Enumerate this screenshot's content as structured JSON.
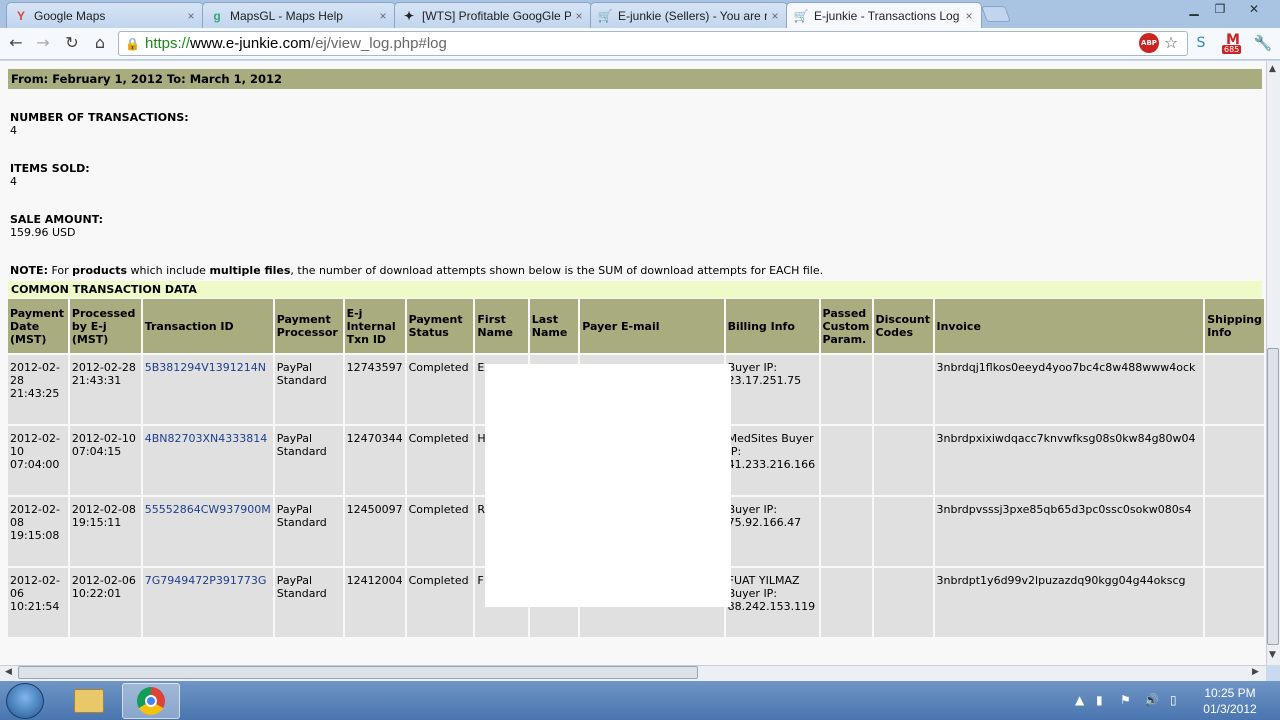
{
  "tabs": [
    {
      "label": "Google Maps",
      "icon": "google-icon",
      "close": "×"
    },
    {
      "label": "MapsGL - Maps Help",
      "icon": "google-icon",
      "close": "×"
    },
    {
      "label": "[WTS] Profitable GoogGle Pl",
      "icon": "forum-icon",
      "close": "×"
    },
    {
      "label": "E-junkie (Sellers) - You are r",
      "icon": "cart-icon",
      "close": "×"
    },
    {
      "label": "E-junkie - Transactions Log",
      "icon": "cart-icon",
      "close": "×"
    }
  ],
  "omnibox": {
    "scheme": "https://",
    "host": "www.e-junkie.com",
    "path": "/ej/view_log.php#log"
  },
  "extensions": {
    "abp": "ABP",
    "gmail_count": "685"
  },
  "report": {
    "range": "From: February 1, 2012 To: March 1, 2012",
    "num_transactions_label": "NUMBER OF TRANSACTIONS:",
    "num_transactions": "4",
    "items_sold_label": "ITEMS SOLD:",
    "items_sold": "4",
    "sale_amount_label": "SALE AMOUNT:",
    "sale_amount": "159.96 USD",
    "note_label": "NOTE:",
    "note_1": " For ",
    "note_products": "products",
    "note_2": " which include ",
    "note_multiple": "multiple files",
    "note_3": ", the number of download attempts shown below is the SUM of download attempts for EACH file.",
    "common_title": "COMMON TRANSACTION DATA"
  },
  "table": {
    "headers": [
      "Payment Date (MST)",
      "Processed by E-j (MST)",
      "Transaction ID",
      "Payment Processor",
      "E-j Internal Txn ID",
      "Payment Status",
      "First Name",
      "Last Name",
      "Payer E-mail",
      "Billing Info",
      "Passed Custom Param.",
      "Discount Codes",
      "Invoice",
      "Shipping Info"
    ],
    "rows": [
      {
        "pay_date": "2012-02-28 21:43:25",
        "proc_date": "2012-02-28 21:43:31",
        "txn_id": "5B381294V1391214N",
        "processor": "PayPal Standard",
        "internal_id": "12743597",
        "status": "Completed",
        "first": "E",
        "last": "",
        "email": "",
        "billing": "Buyer IP: 23.17.251.75",
        "custom": "",
        "discount": "",
        "invoice": "3nbrdqj1flkos0eeyd4yoo7bc4c8w488www4ock",
        "shipping": ""
      },
      {
        "pay_date": "2012-02-10 07:04:00",
        "proc_date": "2012-02-10 07:04:15",
        "txn_id": "4BN82703XN4333814",
        "processor": "PayPal Standard",
        "internal_id": "12470344",
        "status": "Completed",
        "first": "H",
        "last": "",
        "email": "",
        "billing": "MedSites Buyer IP: 41.233.216.166",
        "custom": "",
        "discount": "",
        "invoice": "3nbrdpxixiwdqacc7knvwfksg08s0kw84g80w04",
        "shipping": ""
      },
      {
        "pay_date": "2012-02-08 19:15:08",
        "proc_date": "2012-02-08 19:15:11",
        "txn_id": "55552864CW937900M",
        "processor": "PayPal Standard",
        "internal_id": "12450097",
        "status": "Completed",
        "first": "R S",
        "last": "",
        "email": "",
        "billing": "Buyer IP: 75.92.166.47",
        "custom": "",
        "discount": "",
        "invoice": "3nbrdpvsssj3pxe85qb65d3pc0ssc0sokw080s4",
        "shipping": ""
      },
      {
        "pay_date": "2012-02-06 10:21:54",
        "proc_date": "2012-02-06 10:22:01",
        "txn_id": "7G7949472P391773G",
        "processor": "PayPal Standard",
        "internal_id": "12412004",
        "status": "Completed",
        "first": "F",
        "last": "",
        "email": "",
        "billing": "FUAT YILMAZ Buyer IP: 88.242.153.119",
        "custom": "",
        "discount": "",
        "invoice": "3nbrdpt1y6d99v2lpuzazdq90kgg04g44okscg",
        "shipping": ""
      }
    ]
  },
  "clock": {
    "time": "10:25 PM",
    "date": "01/3/2012"
  }
}
